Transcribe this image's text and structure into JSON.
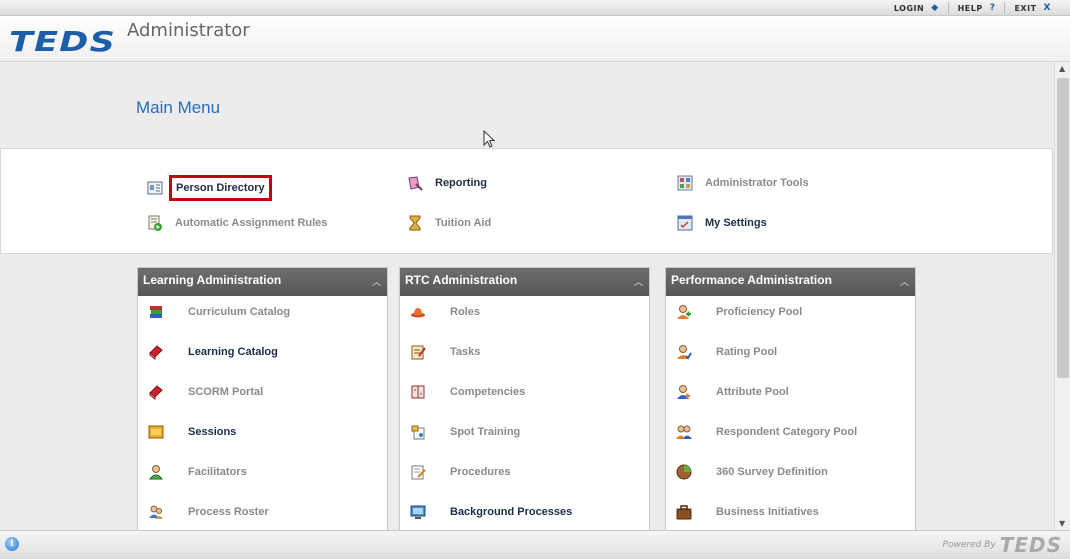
{
  "topbar": {
    "links": [
      {
        "label": "LOGIN",
        "icon": "◆"
      },
      {
        "label": "HELP",
        "icon": "?"
      },
      {
        "label": "EXIT",
        "icon": "X"
      }
    ]
  },
  "header": {
    "logo": "TEDS",
    "subtitle": "Administrator"
  },
  "main": {
    "title": "Main Menu",
    "quick_links": [
      {
        "label": "Person Directory",
        "icon": "person-directory-icon",
        "highlighted": true
      },
      {
        "label": "Reporting",
        "icon": "reporting-icon"
      },
      {
        "label": "Administrator Tools",
        "icon": "admin-tools-icon"
      },
      {
        "label": "Automatic Assignment Rules",
        "icon": "assignment-rules-icon"
      },
      {
        "label": "Tuition Aid",
        "icon": "tuition-aid-icon"
      },
      {
        "label": "My Settings",
        "icon": "my-settings-icon"
      }
    ]
  },
  "panels": [
    {
      "title": "Learning Administration",
      "items": [
        {
          "label": "Curriculum Catalog",
          "icon": "books-icon"
        },
        {
          "label": "Learning Catalog",
          "icon": "book-red-icon"
        },
        {
          "label": "SCORM Portal",
          "icon": "book-red-icon"
        },
        {
          "label": "Sessions",
          "icon": "sessions-icon"
        },
        {
          "label": "Facilitators",
          "icon": "person-icon"
        },
        {
          "label": "Process Roster",
          "icon": "roster-icon"
        }
      ]
    },
    {
      "title": "RTC Administration",
      "items": [
        {
          "label": "Roles",
          "icon": "hat-icon"
        },
        {
          "label": "Tasks",
          "icon": "tasks-icon"
        },
        {
          "label": "Competencies",
          "icon": "competencies-icon"
        },
        {
          "label": "Spot Training",
          "icon": "spot-training-icon"
        },
        {
          "label": "Procedures",
          "icon": "procedures-icon"
        },
        {
          "label": "Background Processes",
          "icon": "monitor-icon"
        }
      ]
    },
    {
      "title": "Performance Administration",
      "items": [
        {
          "label": "Proficiency Pool",
          "icon": "proficiency-icon"
        },
        {
          "label": "Rating Pool",
          "icon": "rating-icon"
        },
        {
          "label": "Attribute Pool",
          "icon": "attribute-icon"
        },
        {
          "label": "Respondent Category Pool",
          "icon": "respondent-icon"
        },
        {
          "label": "360 Survey Definition",
          "icon": "survey-icon"
        },
        {
          "label": "Business Initiatives",
          "icon": "briefcase-icon"
        }
      ]
    }
  ],
  "footer": {
    "powered_by": "Powered By",
    "logo": "TEDS"
  },
  "colors": {
    "brand_blue": "#1d5ea8",
    "title_blue": "#2a6cb8",
    "highlight_red": "#c40010",
    "panel_header": "#5e5e5e"
  }
}
